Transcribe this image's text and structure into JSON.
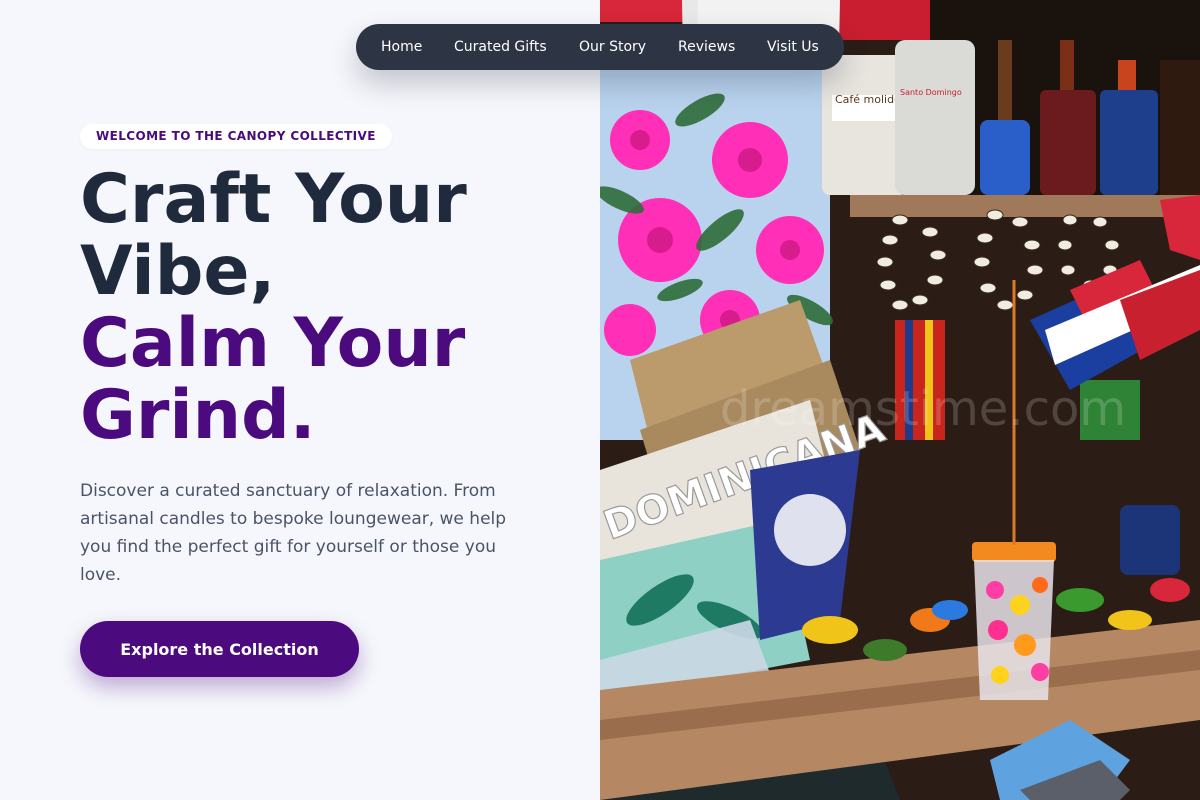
{
  "nav": {
    "items": [
      {
        "label": "Home"
      },
      {
        "label": "Curated Gifts"
      },
      {
        "label": "Our Story"
      },
      {
        "label": "Reviews"
      },
      {
        "label": "Visit Us"
      }
    ]
  },
  "hero": {
    "badge": "WELCOME TO THE CANOPY COLLECTIVE",
    "headline_line1": "Craft Your",
    "headline_line2": "Vibe,",
    "headline_line3": "Calm Your",
    "headline_line4": "Grind.",
    "description": "Discover a curated sanctuary of relaxation. From artisanal candles to bespoke loungewear, we help you find the perfect gift for yourself or those you love.",
    "cta_label": "Explore the Collection"
  },
  "image": {
    "product_labels": [
      "Café molido",
      "Santo Domingo"
    ],
    "bag_text": "DOMINICANA",
    "watermark": "dreamstime.com"
  },
  "colors": {
    "accent": "#4b0a7e",
    "heading": "#1f2a3c",
    "nav_bg": "#2d3544",
    "background": "#f6f7fc"
  }
}
